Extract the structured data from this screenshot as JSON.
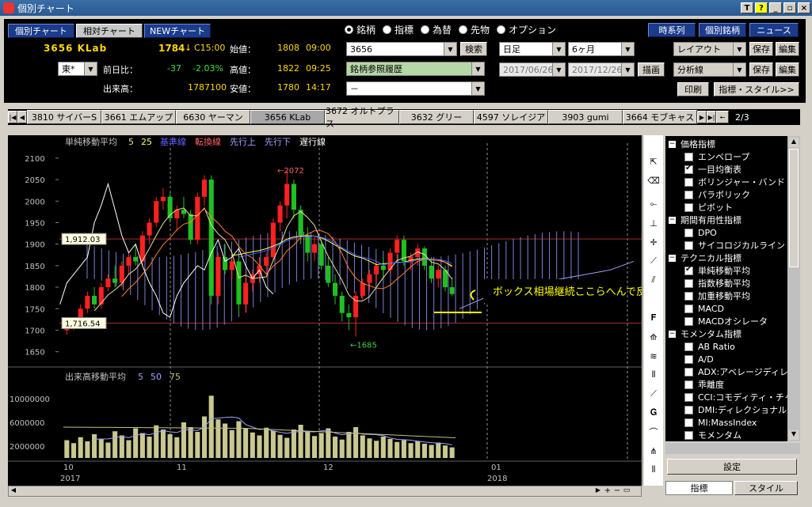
{
  "window": {
    "title": "個別チャート"
  },
  "view_tabs": [
    "個別チャート",
    "相対チャート",
    "NEWチャート"
  ],
  "quote": {
    "code_name": "3656 KLab",
    "price": "1784",
    "arrow": "↓",
    "time": "C15:00",
    "open_label": "始値：",
    "open": "1808",
    "open_time": "09:00",
    "prev_label": "前日比：",
    "change": "-37",
    "change_pct": "-2.03%",
    "high_label": "高値：",
    "high": "1822",
    "high_time": "09:25",
    "volume_label": "出来高：",
    "volume": "1787100",
    "low_label": "安値：",
    "low": "1780",
    "low_time": "14:17",
    "market": "東*"
  },
  "type_radios": [
    {
      "label": "銘柄",
      "on": true
    },
    {
      "label": "指標",
      "on": false
    },
    {
      "label": "為替",
      "on": false
    },
    {
      "label": "先物",
      "on": false
    },
    {
      "label": "オプション",
      "on": false
    }
  ],
  "search": {
    "value": "3656",
    "button": "検索",
    "history": "銘柄参照履歴",
    "third": "－"
  },
  "period": {
    "interval": "日足",
    "range": "6ヶ月",
    "from": "2017/06/26",
    "to": "2017/12/26",
    "draw": "描画"
  },
  "right_buttons": {
    "timeseries": "時系列",
    "individual": "個別銘柄",
    "news": "ニュース",
    "layout": "レイアウト",
    "save": "保存",
    "edit": "編集",
    "analysis": "分析線",
    "print": "印刷",
    "indicator_style": "指標・スタイル>>"
  },
  "stock_tabs": [
    "3810 サイバーS",
    "3661 エムアップ",
    "6630 ヤーマン",
    "3656 KLab",
    "3672 オルトプラス",
    "3632 グリー",
    "4597 ソレイジア",
    "3903 gumi",
    "3664 モブキャス"
  ],
  "page_indicator": "2/3",
  "legend_main": [
    {
      "text": "単純移動平均",
      "color": "#c0c0c0"
    },
    {
      "text": "5",
      "color": "#e0e0a0"
    },
    {
      "text": "25",
      "color": "#ffff60"
    },
    {
      "text": "基準線",
      "color": "#6060ff"
    },
    {
      "text": "転換線",
      "color": "#ff6060"
    },
    {
      "text": "先行上",
      "color": "#a0a0ff"
    },
    {
      "text": "先行下",
      "color": "#a0a0ff"
    },
    {
      "text": "遅行線",
      "color": "#ffffff"
    }
  ],
  "legend_volume": [
    {
      "text": "出来高移動平均",
      "color": "#c0c0c0"
    },
    {
      "text": "5",
      "color": "#a0a0ff"
    },
    {
      "text": "50",
      "color": "#a0a0ff"
    },
    {
      "text": "75",
      "color": "#c0c080"
    }
  ],
  "annotation": {
    "text": "ボックス相場継続ここらへんで反発か？",
    "high_mark": "←2072",
    "low_mark": "←1685",
    "box_top": "1,912.03",
    "box_bottom": "1,716.54"
  },
  "x_labels": [
    "10",
    "11",
    "12",
    "01"
  ],
  "year_labels": [
    "2017",
    "2018"
  ],
  "chart_data": [
    {
      "type": "candlestick",
      "title": "",
      "ylim": [
        1620,
        2120
      ],
      "y_ticks": [
        1650,
        1700,
        1750,
        1800,
        1850,
        1900,
        1950,
        2000,
        2050,
        2100
      ],
      "grid": true,
      "ohlc": [
        [
          1700,
          1720,
          1690,
          1710
        ],
        [
          1710,
          1730,
          1700,
          1725
        ],
        [
          1725,
          1760,
          1715,
          1750
        ],
        [
          1750,
          1790,
          1740,
          1780
        ],
        [
          1780,
          1800,
          1750,
          1760
        ],
        [
          1760,
          1810,
          1750,
          1800
        ],
        [
          1800,
          1830,
          1790,
          1820
        ],
        [
          1820,
          1850,
          1800,
          1810
        ],
        [
          1810,
          1860,
          1800,
          1850
        ],
        [
          1850,
          1880,
          1830,
          1870
        ],
        [
          1870,
          1900,
          1850,
          1860
        ],
        [
          1860,
          1930,
          1850,
          1920
        ],
        [
          1920,
          1960,
          1900,
          1950
        ],
        [
          1950,
          2010,
          1940,
          2000
        ],
        [
          2000,
          2030,
          1980,
          2010
        ],
        [
          2010,
          2020,
          1950,
          1960
        ],
        [
          1960,
          1990,
          1930,
          1980
        ],
        [
          1980,
          2010,
          1960,
          1970
        ],
        [
          1970,
          1980,
          1900,
          1910
        ],
        [
          1910,
          2020,
          1900,
          2010
        ],
        [
          2010,
          2060,
          1990,
          2050
        ],
        [
          2050,
          2060,
          1760,
          1780
        ],
        [
          1780,
          1880,
          1760,
          1870
        ],
        [
          1870,
          1900,
          1830,
          1840
        ],
        [
          1840,
          1880,
          1820,
          1860
        ],
        [
          1860,
          1870,
          1740,
          1760
        ],
        [
          1760,
          1830,
          1740,
          1810
        ],
        [
          1810,
          1840,
          1790,
          1830
        ],
        [
          1830,
          1870,
          1810,
          1850
        ],
        [
          1850,
          1880,
          1830,
          1870
        ],
        [
          1870,
          1960,
          1860,
          1950
        ],
        [
          1950,
          2000,
          1930,
          1990
        ],
        [
          1990,
          2072,
          1960,
          2040
        ],
        [
          2040,
          2050,
          1960,
          1980
        ],
        [
          1980,
          1990,
          1900,
          1920
        ],
        [
          1920,
          1940,
          1860,
          1880
        ],
        [
          1880,
          1920,
          1860,
          1900
        ],
        [
          1900,
          1910,
          1840,
          1850
        ],
        [
          1850,
          1870,
          1800,
          1810
        ],
        [
          1810,
          1830,
          1760,
          1780
        ],
        [
          1780,
          1790,
          1720,
          1740
        ],
        [
          1740,
          1760,
          1700,
          1730
        ],
        [
          1730,
          1790,
          1685,
          1780
        ],
        [
          1780,
          1820,
          1770,
          1810
        ],
        [
          1810,
          1840,
          1790,
          1830
        ],
        [
          1830,
          1860,
          1810,
          1850
        ],
        [
          1850,
          1870,
          1820,
          1840
        ],
        [
          1840,
          1890,
          1830,
          1880
        ],
        [
          1880,
          1920,
          1860,
          1910
        ],
        [
          1910,
          1920,
          1850,
          1860
        ],
        [
          1860,
          1880,
          1840,
          1870
        ],
        [
          1870,
          1900,
          1850,
          1890
        ],
        [
          1890,
          1895,
          1840,
          1850
        ],
        [
          1850,
          1870,
          1810,
          1820
        ],
        [
          1820,
          1850,
          1800,
          1840
        ],
        [
          1840,
          1850,
          1790,
          1800
        ],
        [
          1800,
          1822,
          1780,
          1784
        ]
      ],
      "box_top": 1912.03,
      "box_bottom": 1716.54
    },
    {
      "type": "bar",
      "title": "",
      "ylim": [
        0,
        12000000
      ],
      "y_ticks": [
        2000000,
        6000000,
        10000000
      ],
      "values": [
        3000000,
        2500000,
        3500000,
        2800000,
        4000000,
        3200000,
        2600000,
        4500000,
        3800000,
        3000000,
        5000000,
        4200000,
        3600000,
        5500000,
        4800000,
        4000000,
        3500000,
        6000000,
        5200000,
        4400000,
        7000000,
        10500000,
        6500000,
        5800000,
        4700000,
        6200000,
        5000000,
        4300000,
        3800000,
        5100000,
        4600000,
        3900000,
        3400000,
        4800000,
        5600000,
        4500000,
        3700000,
        4200000,
        5000000,
        3600000,
        3100000,
        4400000,
        5200000,
        3800000,
        3300000,
        2900000,
        3600000,
        3200000,
        2700000,
        3000000,
        2500000,
        2800000,
        2400000,
        2200000,
        2600000,
        2100000,
        1787100
      ]
    }
  ]
}
